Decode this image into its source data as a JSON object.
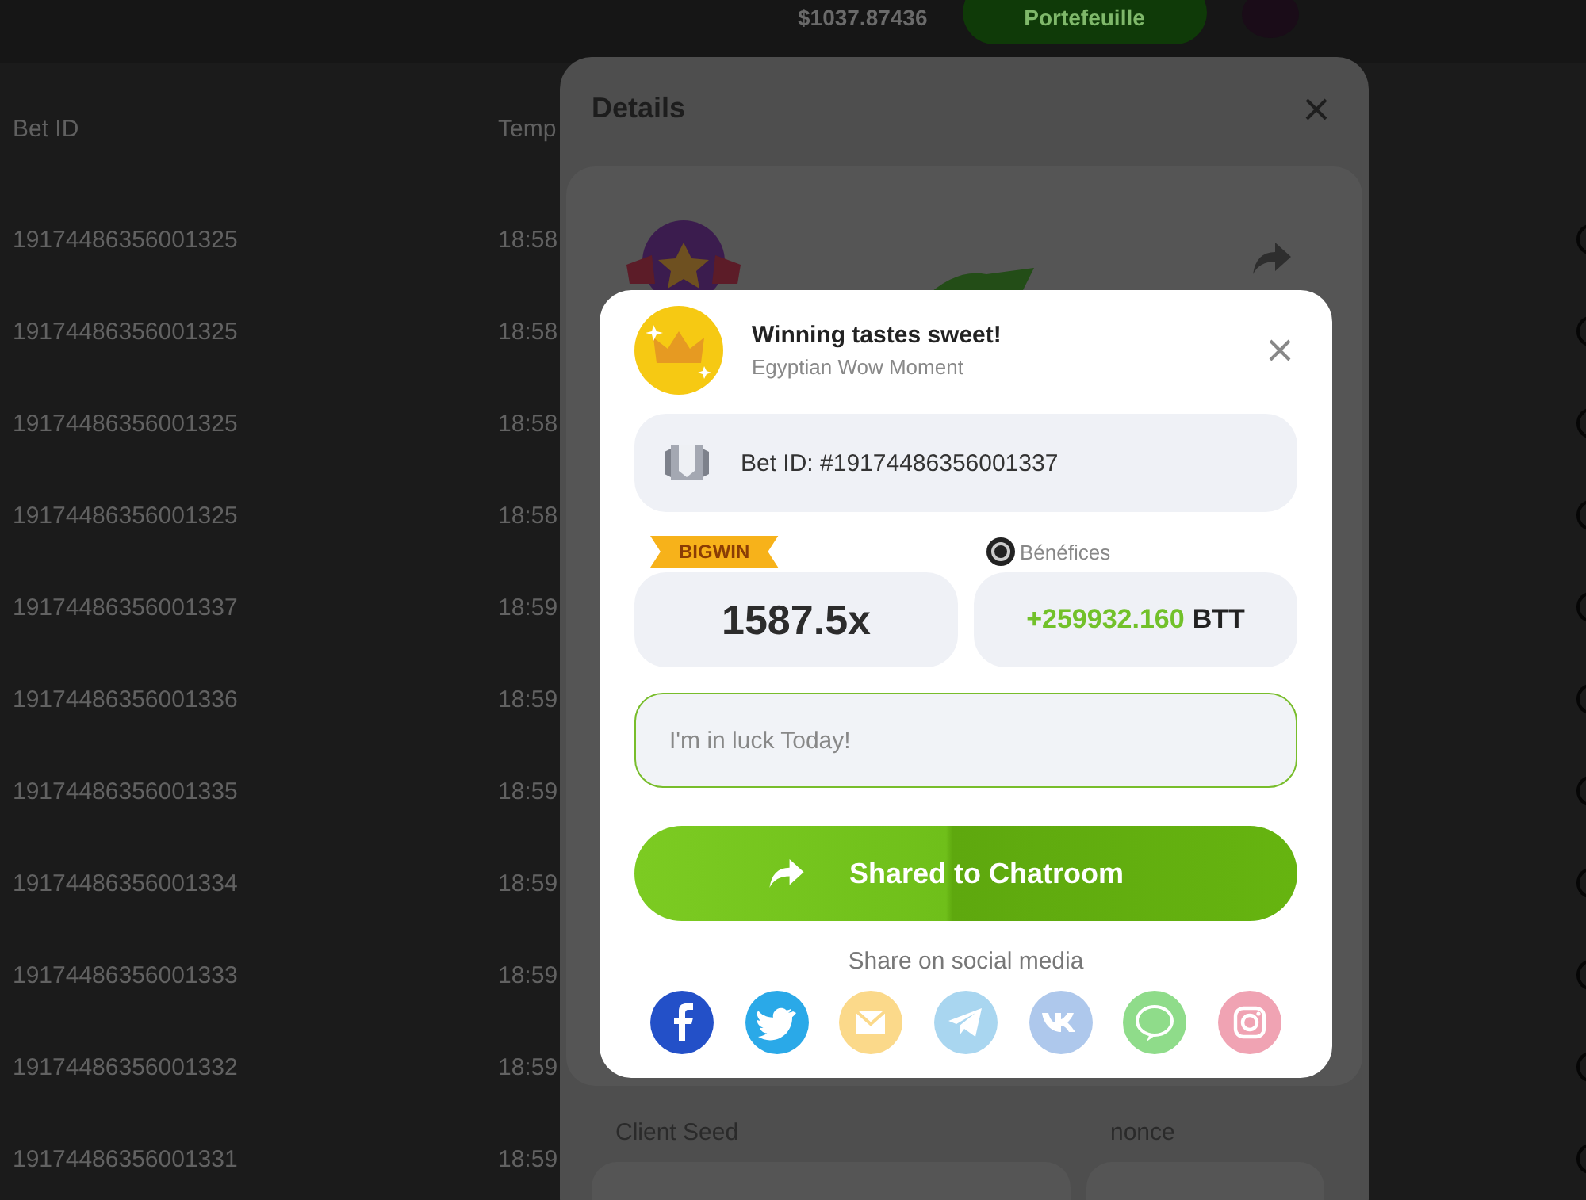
{
  "header": {
    "balance": "$1037.87436",
    "wallet_button": "Portefeuille"
  },
  "table": {
    "columns": [
      "Bet ID",
      "Temp"
    ],
    "rows": [
      {
        "bet_id": "19174486356001325",
        "time": "18:58"
      },
      {
        "bet_id": "19174486356001325",
        "time": "18:58"
      },
      {
        "bet_id": "19174486356001325",
        "time": "18:58"
      },
      {
        "bet_id": "19174486356001325",
        "time": "18:58"
      },
      {
        "bet_id": "19174486356001337",
        "time": "18:59"
      },
      {
        "bet_id": "19174486356001336",
        "time": "18:59"
      },
      {
        "bet_id": "19174486356001335",
        "time": "18:59"
      },
      {
        "bet_id": "19174486356001334",
        "time": "18:59"
      },
      {
        "bet_id": "19174486356001333",
        "time": "18:59"
      },
      {
        "bet_id": "19174486356001332",
        "time": "18:59"
      },
      {
        "bet_id": "19174486356001331",
        "time": "18:59"
      }
    ]
  },
  "details": {
    "title": "Details",
    "client_seed_label": "Client Seed",
    "nonce_label": "nonce"
  },
  "share_popup": {
    "title": "Winning tastes sweet!",
    "subtitle": "Egyptian Wow Moment",
    "bet_id": "Bet ID: #19174486356001337",
    "badge": "BIGWIN",
    "multiplier": "1587.5x",
    "profit_label": "Bénéfices",
    "profit_amount": "+259932.160",
    "currency": "BTT",
    "message": {
      "placeholder": "I'm in luck Today!"
    },
    "share_button": "Shared to Chatroom",
    "social_label": "Share on social media",
    "social": [
      {
        "kind": "facebook",
        "color": "#2350c8"
      },
      {
        "kind": "twitter",
        "color": "#2aa9e8"
      },
      {
        "kind": "email",
        "color": "#fbd98a"
      },
      {
        "kind": "telegram",
        "color": "#a9d6f0"
      },
      {
        "kind": "vk",
        "color": "#aec8ec"
      },
      {
        "kind": "line",
        "color": "#8fdc8a"
      },
      {
        "kind": "instagram",
        "color": "#f0a3b3"
      }
    ]
  }
}
